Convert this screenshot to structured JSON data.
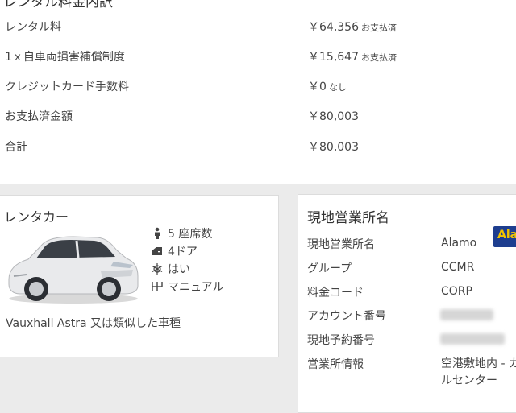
{
  "breakdown": {
    "title": "レンタル料金内訳",
    "rows": [
      {
        "label": "レンタル料",
        "value": "￥64,356",
        "suffix": "お支払済"
      },
      {
        "label": "1ｘ自車両損害補償制度",
        "value": "￥15,647",
        "suffix": "お支払済"
      },
      {
        "label": "クレジットカード手数料",
        "value": "￥0",
        "suffix": "なし"
      },
      {
        "label": "お支払済金額",
        "value": "￥80,003",
        "suffix": ""
      },
      {
        "label": "合計",
        "value": "￥80,003",
        "suffix": ""
      }
    ]
  },
  "car_card": {
    "title": "レンタカー",
    "features": {
      "seats": "5 座席数",
      "doors": "4ドア",
      "aircon": "はい",
      "transmission": "マニュアル"
    },
    "icons": [
      "person-icon",
      "door-icon",
      "snowflake-icon",
      "gearshift-icon"
    ],
    "car_name": "Vauxhall Astra 又は類似した車種"
  },
  "station_card": {
    "title": "現地営業所名",
    "logo_text": "Ala",
    "rows": [
      {
        "label": "現地営業所名",
        "value": "Alamo"
      },
      {
        "label": "グループ",
        "value": "CCMR"
      },
      {
        "label": "料金コード",
        "value": "CORP"
      },
      {
        "label": "アカウント番号",
        "value": ""
      },
      {
        "label": "現地予約番号",
        "value": ""
      },
      {
        "label": "営業所情報",
        "value": "空港敷地内 - カ\nルセンター"
      }
    ]
  },
  "colors": {
    "background": "#ebebeb",
    "card": "#ffffff",
    "logo_bg": "#1e3e8f",
    "logo_text": "#f2c400"
  }
}
